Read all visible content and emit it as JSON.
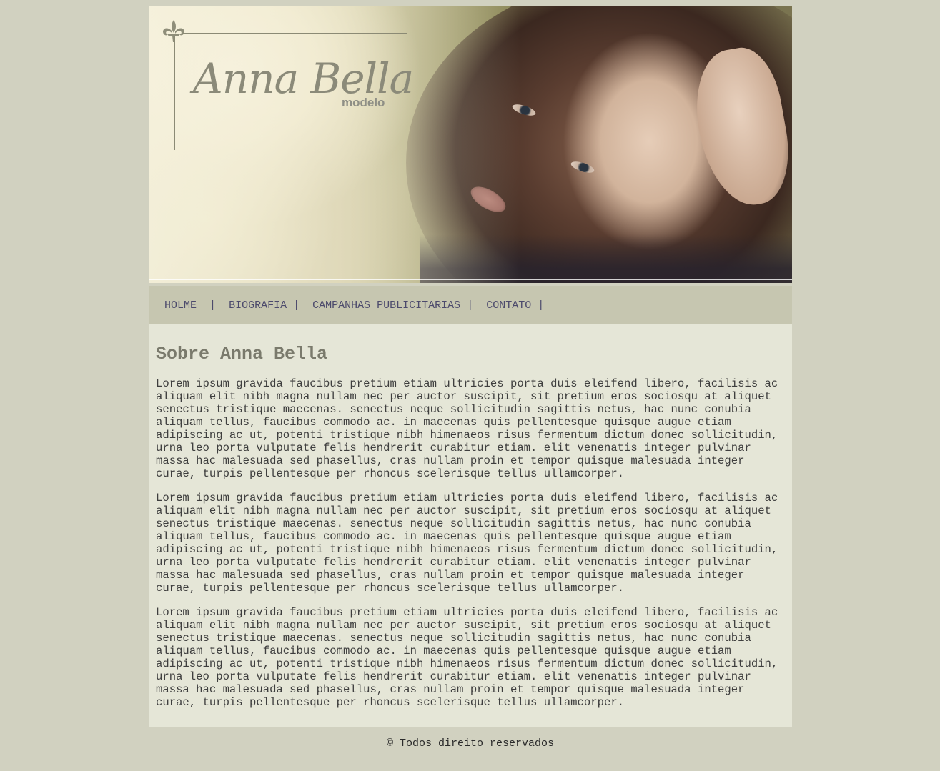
{
  "header": {
    "logo_name": "Anna Bella",
    "logo_subtitle": "modelo",
    "logo_icon": "fleur-de-lis-icon"
  },
  "nav": {
    "items": [
      {
        "label": "HOLME"
      },
      {
        "label": "BIOGRAFIA"
      },
      {
        "label": "CAMPANHAS PUBLICITARIAS"
      },
      {
        "label": "CONTATO"
      }
    ],
    "separator": "|"
  },
  "main": {
    "title": "Sobre Anna Bella",
    "paragraphs": [
      "Lorem ipsum gravida faucibus pretium etiam ultricies porta duis eleifend libero, facilisis ac aliquam elit nibh magna nullam nec per auctor suscipit, sit pretium eros sociosqu at aliquet senectus tristique maecenas. senectus neque sollicitudin sagittis netus, hac nunc conubia aliquam tellus, faucibus commodo ac. in maecenas quis pellentesque quisque augue etiam adipiscing ac ut, potenti tristique nibh himenaeos risus fermentum dictum donec sollicitudin, urna leo porta vulputate felis hendrerit curabitur etiam. elit venenatis integer pulvinar massa hac malesuada sed phasellus, cras nullam proin et tempor quisque malesuada integer curae, turpis pellentesque per rhoncus scelerisque tellus ullamcorper.",
      "Lorem ipsum gravida faucibus pretium etiam ultricies porta duis eleifend libero, facilisis ac aliquam elit nibh magna nullam nec per auctor suscipit, sit pretium eros sociosqu at aliquet senectus tristique maecenas. senectus neque sollicitudin sagittis netus, hac nunc conubia aliquam tellus, faucibus commodo ac. in maecenas quis pellentesque quisque augue etiam adipiscing ac ut, potenti tristique nibh himenaeos risus fermentum dictum donec sollicitudin, urna leo porta vulputate felis hendrerit curabitur etiam. elit venenatis integer pulvinar massa hac malesuada sed phasellus, cras nullam proin et tempor quisque malesuada integer curae, turpis pellentesque per rhoncus scelerisque tellus ullamcorper.",
      "Lorem ipsum gravida faucibus pretium etiam ultricies porta duis eleifend libero, facilisis ac aliquam elit nibh magna nullam nec per auctor suscipit, sit pretium eros sociosqu at aliquet senectus tristique maecenas. senectus neque sollicitudin sagittis netus, hac nunc conubia aliquam tellus, faucibus commodo ac. in maecenas quis pellentesque quisque augue etiam adipiscing ac ut, potenti tristique nibh himenaeos risus fermentum dictum donec sollicitudin, urna leo porta vulputate felis hendrerit curabitur etiam. elit venenatis integer pulvinar massa hac malesuada sed phasellus, cras nullam proin et tempor quisque malesuada integer curae, turpis pellentesque per rhoncus scelerisque tellus ullamcorper."
    ]
  },
  "footer": {
    "text": "© Todos direito reservados"
  },
  "colors": {
    "page_background": "#d1d1c0",
    "nav_background": "#c6c6b0",
    "content_background": "#e5e6d7",
    "nav_link": "#4c4a6c",
    "title": "#7a7a6c",
    "body_text": "#3e3e3e"
  }
}
